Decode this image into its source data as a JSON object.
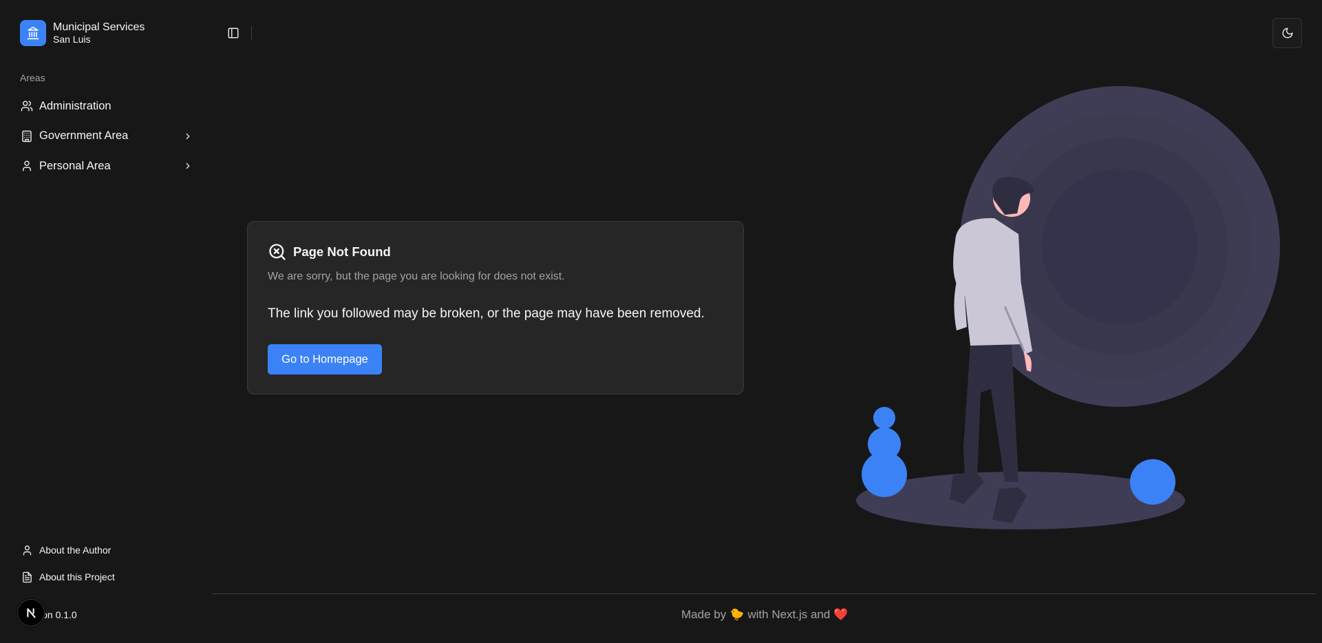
{
  "brand": {
    "title": "Municipal Services",
    "subtitle": "San Luis"
  },
  "sidebar": {
    "group_label": "Areas",
    "items": [
      {
        "label": "Administration",
        "icon": "users-icon",
        "has_children": false
      },
      {
        "label": "Government Area",
        "icon": "building-icon",
        "has_children": true
      },
      {
        "label": "Personal Area",
        "icon": "user-icon",
        "has_children": true
      }
    ],
    "footer_items": [
      {
        "label": "About the Author",
        "icon": "user-icon"
      },
      {
        "label": "About this Project",
        "icon": "file-text-icon"
      }
    ],
    "version": "ion 0.1.0"
  },
  "card": {
    "title": "Page Not Found",
    "description": "We are sorry, but the page you are looking for does not exist.",
    "body": "The link you followed may be broken, or the page may have been removed.",
    "button": "Go to Homepage"
  },
  "footer": {
    "made_by": "Made by",
    "chick": "🐤",
    "with": "with Next.js and",
    "heart": "❤️"
  },
  "colors": {
    "accent": "#3b82f6",
    "background": "#171717",
    "card": "#262626",
    "illustration_circle": "#3f3d56"
  }
}
